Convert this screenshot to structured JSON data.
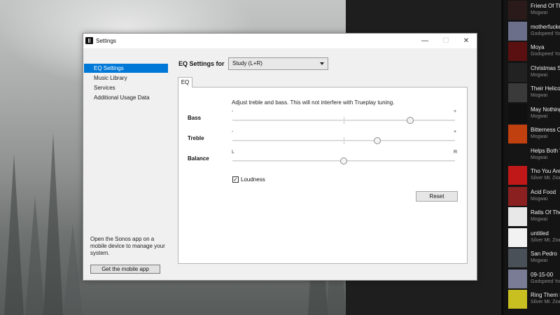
{
  "window": {
    "title": "Settings",
    "minimize": "—",
    "maximize": "☐",
    "close": "✕"
  },
  "sidebar": {
    "items": [
      {
        "label": "EQ Settings",
        "active": true
      },
      {
        "label": "Music Library",
        "active": false
      },
      {
        "label": "Services",
        "active": false
      },
      {
        "label": "Additional Usage Data",
        "active": false
      }
    ],
    "mobile_note": "Open the Sonos app on a mobile device to manage your system.",
    "mobile_button": "Get the mobile app"
  },
  "eq": {
    "for_label": "EQ Settings for",
    "selected_room": "Study (L+R)",
    "tab_label": "EQ",
    "note": "Adjust treble and bass. This will not interfere with Trueplay tuning.",
    "bass": {
      "label": "Bass",
      "min_label": "-",
      "max_label": "+",
      "level": 0.8
    },
    "treble": {
      "label": "Treble",
      "min_label": "-",
      "max_label": "+",
      "level": 0.65
    },
    "balance": {
      "label": "Balance",
      "min_label": "L",
      "max_label": "R",
      "level": 0.5
    },
    "loudness": {
      "label": "Loudness",
      "checked": true,
      "check_glyph": "✓"
    },
    "reset_label": "Reset"
  },
  "tracks": [
    {
      "title": "Friend Of The",
      "artist": "Mogwai",
      "color": "#2a1a1a"
    },
    {
      "title": "motherfucke",
      "artist": "Godspeed Yo",
      "color": "#6b6f8a"
    },
    {
      "title": "Moya",
      "artist": "Godspeed Yo",
      "color": "#5a1010"
    },
    {
      "title": "Christmas Ste",
      "artist": "Mogwai",
      "color": "#222222"
    },
    {
      "title": "Their Helicop",
      "artist": "Mogwai",
      "color": "#3a3a3a"
    },
    {
      "title": "May Nothing",
      "artist": "Mogwai",
      "color": "#101010"
    },
    {
      "title": "Bitterness Ce",
      "artist": "Mogwai",
      "color": "#c04010"
    },
    {
      "title": "Helps Both W",
      "artist": "Mogwai",
      "color": "#151515"
    },
    {
      "title": "Tho You Are C",
      "artist": "Silver Mt. Zion",
      "color": "#c01818"
    },
    {
      "title": "Acid Food",
      "artist": "Mogwai",
      "color": "#8a2020"
    },
    {
      "title": "Ratts Of The",
      "artist": "Mogwai",
      "color": "#e8e8e8"
    },
    {
      "title": "untitled",
      "artist": "Silver Mt. Zion",
      "color": "#f2f2f2"
    },
    {
      "title": "San Pedro",
      "artist": "Mogwai",
      "color": "#4a5058"
    },
    {
      "title": "09-15-00",
      "artist": "Godspeed Yo",
      "color": "#7a7c95"
    },
    {
      "title": "Ring Them Be",
      "artist": "Silver Mt. Zion",
      "color": "#c8c020"
    }
  ]
}
